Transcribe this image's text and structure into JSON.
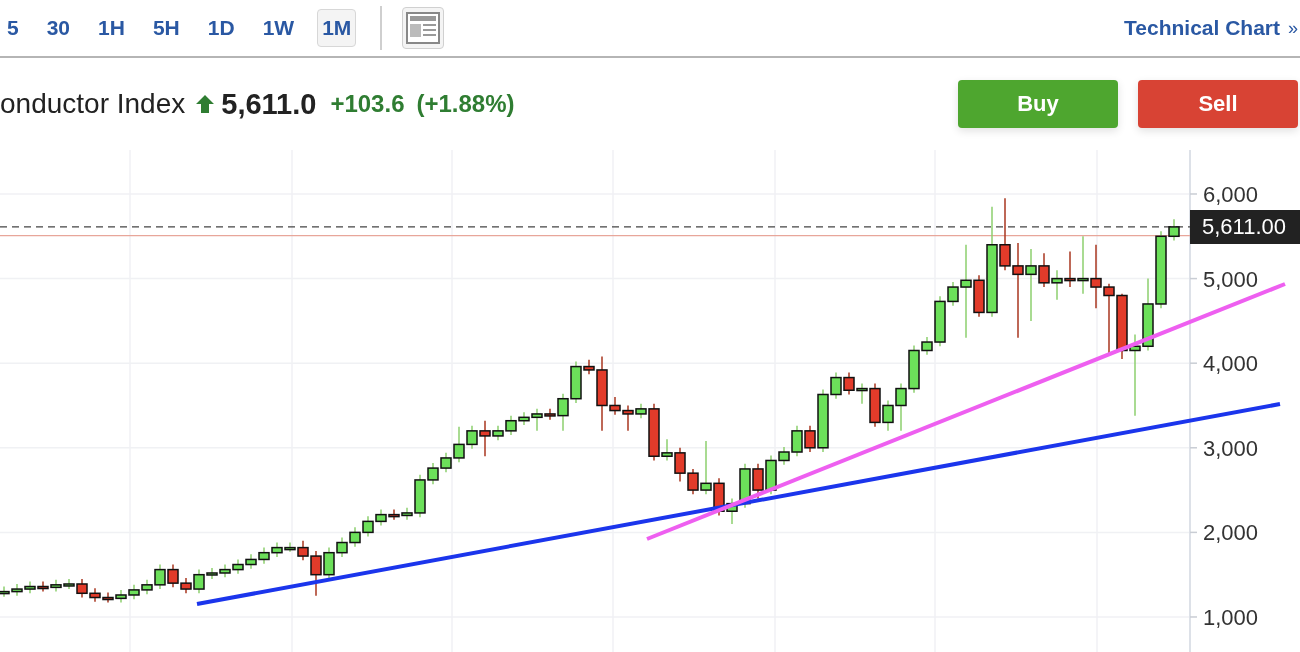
{
  "intervals": [
    {
      "label": "5",
      "selected": false
    },
    {
      "label": "30",
      "selected": false
    },
    {
      "label": "1H",
      "selected": false
    },
    {
      "label": "5H",
      "selected": false
    },
    {
      "label": "1D",
      "selected": false
    },
    {
      "label": "1W",
      "selected": false
    },
    {
      "label": "1M",
      "selected": true
    }
  ],
  "technical_link": {
    "label": "Technical Chart",
    "chevron": "»"
  },
  "quote": {
    "name": "onductor Index",
    "price": "5,611.0",
    "change": "+103.6",
    "change_percent": "(+1.88%)"
  },
  "buttons": [
    {
      "label": "Buy",
      "kind": "buy"
    },
    {
      "label": "Sell",
      "kind": "sell"
    }
  ],
  "chart_data": {
    "type": "candlestick",
    "ylim": [
      586,
      6520
    ],
    "grid": true,
    "yticks": [
      {
        "value": 1000,
        "label": "1,000"
      },
      {
        "value": 2000,
        "label": "2,000"
      },
      {
        "value": 3000,
        "label": "3,000"
      },
      {
        "value": 4000,
        "label": "4,000"
      },
      {
        "value": 5000,
        "label": "5,000"
      },
      {
        "value": 6000,
        "label": "6,000"
      }
    ],
    "ohlc": [
      [
        1290,
        1360,
        1240,
        1300
      ],
      [
        1300,
        1390,
        1250,
        1330
      ],
      [
        1330,
        1420,
        1280,
        1360
      ],
      [
        1360,
        1420,
        1300,
        1350
      ],
      [
        1350,
        1440,
        1300,
        1380
      ],
      [
        1380,
        1450,
        1330,
        1390
      ],
      [
        1390,
        1450,
        1230,
        1280
      ],
      [
        1280,
        1340,
        1180,
        1230
      ],
      [
        1230,
        1290,
        1170,
        1220
      ],
      [
        1220,
        1320,
        1170,
        1260
      ],
      [
        1260,
        1380,
        1210,
        1320
      ],
      [
        1320,
        1440,
        1270,
        1380
      ],
      [
        1380,
        1620,
        1330,
        1560
      ],
      [
        1560,
        1620,
        1350,
        1400
      ],
      [
        1400,
        1460,
        1280,
        1330
      ],
      [
        1330,
        1560,
        1280,
        1500
      ],
      [
        1500,
        1580,
        1450,
        1520
      ],
      [
        1520,
        1620,
        1470,
        1560
      ],
      [
        1560,
        1680,
        1510,
        1620
      ],
      [
        1620,
        1740,
        1570,
        1680
      ],
      [
        1680,
        1820,
        1630,
        1760
      ],
      [
        1760,
        1880,
        1710,
        1820
      ],
      [
        1820,
        1880,
        1770,
        1820
      ],
      [
        1820,
        1900,
        1670,
        1720
      ],
      [
        1720,
        1780,
        1250,
        1500
      ],
      [
        1500,
        1820,
        1450,
        1760
      ],
      [
        1760,
        1940,
        1710,
        1880
      ],
      [
        1880,
        2060,
        1830,
        2000
      ],
      [
        2000,
        2190,
        1950,
        2130
      ],
      [
        2130,
        2270,
        2080,
        2210
      ],
      [
        2210,
        2270,
        2150,
        2200
      ],
      [
        2200,
        2290,
        2150,
        2230
      ],
      [
        2230,
        2680,
        2180,
        2620
      ],
      [
        2620,
        2820,
        2570,
        2760
      ],
      [
        2760,
        2940,
        2710,
        2880
      ],
      [
        2880,
        3250,
        2830,
        3040
      ],
      [
        3040,
        3260,
        2990,
        3200
      ],
      [
        3200,
        3320,
        2900,
        3140
      ],
      [
        3140,
        3260,
        3090,
        3200
      ],
      [
        3200,
        3380,
        3150,
        3320
      ],
      [
        3320,
        3420,
        3270,
        3360
      ],
      [
        3360,
        3460,
        3200,
        3400
      ],
      [
        3400,
        3460,
        3330,
        3380
      ],
      [
        3380,
        3640,
        3200,
        3580
      ],
      [
        3580,
        4020,
        3530,
        3960
      ],
      [
        3960,
        4040,
        3870,
        3920
      ],
      [
        3920,
        4080,
        3200,
        3500
      ],
      [
        3500,
        3600,
        3390,
        3440
      ],
      [
        3440,
        3500,
        3200,
        3400
      ],
      [
        3400,
        3520,
        3350,
        3460
      ],
      [
        3460,
        3520,
        2850,
        2900
      ],
      [
        2900,
        3100,
        2850,
        2940
      ],
      [
        2940,
        3000,
        2600,
        2700
      ],
      [
        2700,
        2750,
        2450,
        2500
      ],
      [
        2500,
        3080,
        2450,
        2580
      ],
      [
        2580,
        2640,
        2200,
        2250
      ],
      [
        2250,
        2400,
        2100,
        2340
      ],
      [
        2340,
        2810,
        2290,
        2750
      ],
      [
        2750,
        2810,
        2400,
        2500
      ],
      [
        2500,
        2910,
        2450,
        2850
      ],
      [
        2850,
        3010,
        2800,
        2950
      ],
      [
        2950,
        3260,
        2900,
        3200
      ],
      [
        3200,
        3260,
        2950,
        3000
      ],
      [
        3000,
        3690,
        2950,
        3630
      ],
      [
        3630,
        3890,
        3580,
        3830
      ],
      [
        3830,
        3890,
        3630,
        3680
      ],
      [
        3680,
        3760,
        3520,
        3700
      ],
      [
        3700,
        3760,
        3250,
        3300
      ],
      [
        3300,
        3560,
        3200,
        3500
      ],
      [
        3500,
        3760,
        3200,
        3700
      ],
      [
        3700,
        4210,
        3650,
        4150
      ],
      [
        4150,
        4310,
        4100,
        4250
      ],
      [
        4250,
        4790,
        4200,
        4730
      ],
      [
        4730,
        4960,
        4680,
        4900
      ],
      [
        4900,
        5400,
        4300,
        4980
      ],
      [
        4980,
        5040,
        4550,
        4600
      ],
      [
        4600,
        5850,
        4550,
        5400
      ],
      [
        5400,
        5950,
        5100,
        5150
      ],
      [
        5150,
        5420,
        4300,
        5050
      ],
      [
        5050,
        5350,
        4500,
        5150
      ],
      [
        5150,
        5300,
        4900,
        4950
      ],
      [
        4950,
        5100,
        4750,
        5000
      ],
      [
        5000,
        5320,
        4900,
        4980
      ],
      [
        4980,
        5500,
        4820,
        5000
      ],
      [
        5000,
        5400,
        4650,
        4900
      ],
      [
        4900,
        4940,
        4100,
        4800
      ],
      [
        4800,
        4820,
        4050,
        4150
      ],
      [
        4150,
        4340,
        3380,
        4200
      ],
      [
        4200,
        5000,
        4150,
        4700
      ],
      [
        4700,
        5560,
        4650,
        5500
      ],
      [
        5500,
        5700,
        5450,
        5611
      ]
    ],
    "ref_lines": [
      {
        "axis": "y",
        "value": 5611,
        "label": "5,611.00",
        "color": "#444444"
      },
      {
        "axis": "y",
        "value": 5507,
        "color": "#e8a69a"
      }
    ]
  }
}
